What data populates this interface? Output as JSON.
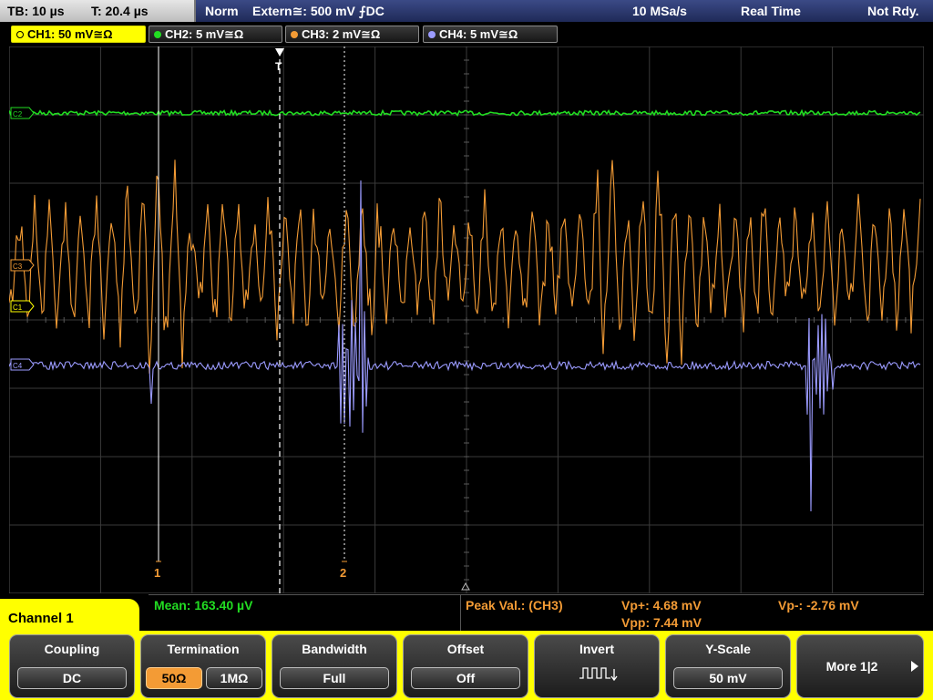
{
  "topbar": {
    "timebase": "TB: 10 µs",
    "trigger_time": "T: 20.4 µs",
    "trigger_mode": "Norm",
    "trigger_source": "Extern≅: 500 mV ⨍DC",
    "sample_rate": "10 MSa/s",
    "acq_mode": "Real Time",
    "status": "Not Rdy."
  },
  "channels": [
    {
      "label": "CH1: 50 mV≅Ω",
      "color": "#ffff00",
      "active": true
    },
    {
      "label": "CH2: 5 mV≅Ω",
      "color": "#22dd22",
      "active": false
    },
    {
      "label": "CH3: 2 mV≅Ω",
      "color": "#f39b35",
      "active": false
    },
    {
      "label": "CH4: 5 mV≅Ω",
      "color": "#9b9bff",
      "active": false
    }
  ],
  "screen": {
    "markers": {
      "c2": "C2",
      "c3": "C3",
      "c1": "C1",
      "c4": "C4",
      "trigger": "T"
    },
    "cursor_labels": {
      "cursor1": "1",
      "cursor2": "2"
    },
    "colors": {
      "ch1": "#ffff00",
      "ch2": "#22dd22",
      "ch3": "#f39b35",
      "ch4": "#9b9bff",
      "grid": "#3a3a3a"
    }
  },
  "measurements": {
    "mean": "Mean: 163.40 µV",
    "peak_label": "Peak Val.:  (CH3)",
    "vp_plus": "Vp+: 4.68 mV",
    "vp_minus": "Vp-: -2.76 mV",
    "vpp": "Vpp: 7.44 mV"
  },
  "menu": {
    "title": "Channel 1",
    "coupling": {
      "label": "Coupling",
      "value": "DC"
    },
    "termination": {
      "label": "Termination",
      "opt1": "50Ω",
      "opt2": "1MΩ"
    },
    "bandwidth": {
      "label": "Bandwidth",
      "value": "Full"
    },
    "offset": {
      "label": "Offset",
      "value": "Off"
    },
    "invert": {
      "label": "Invert",
      "icon": "square-wave-icon"
    },
    "yscale": {
      "label": "Y-Scale",
      "value": "50 mV"
    },
    "more": {
      "label": "More 1|2"
    }
  }
}
